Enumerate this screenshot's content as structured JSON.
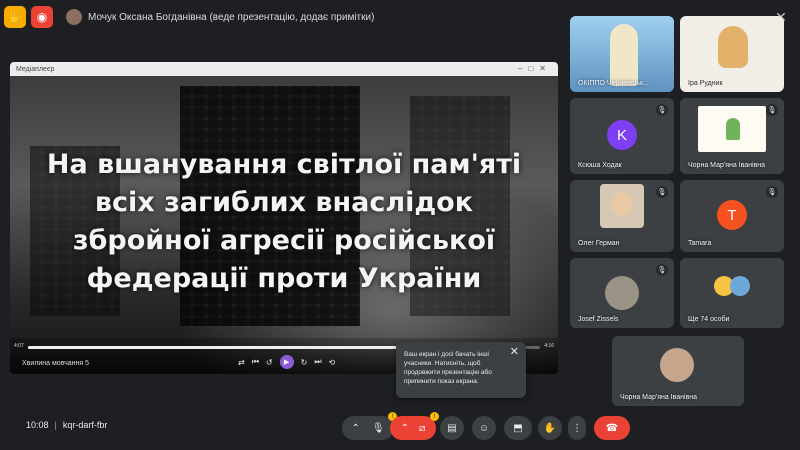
{
  "topbar": {
    "presenter_label": "Мочук Оксана Богданівна (веде презентацію, додає примітки)"
  },
  "presentation": {
    "window_title": "Медіаплеєр",
    "slide_title_lines": [
      "На вшанування світлої пам'яті",
      "всіх загиблих внаслідок",
      "збройної агресії російської",
      "федерації проти України"
    ],
    "media_label": "Хвилина мовчання 5",
    "progress_fraction": 0.96,
    "time_elapsed": "4:07",
    "time_total": "4:16"
  },
  "toast": {
    "message": "Ваш екран і досі бачать інші учасники. Натисніть, щоб продовжити презентацію або припинити показ екрана."
  },
  "participants": [
    {
      "name": "ОКІППО Чернівецьк...",
      "type": "video"
    },
    {
      "name": "Іра Рудник",
      "type": "video"
    },
    {
      "name": "Ксюша Ходак",
      "type": "letter",
      "letter": "K",
      "color": "#7e3ff2"
    },
    {
      "name": "Чорна Мар'яна Іванівна",
      "type": "presentation"
    },
    {
      "name": "Олег Герман",
      "type": "video"
    },
    {
      "name": "Tamara",
      "type": "letter",
      "letter": "T",
      "color": "#f4511e"
    },
    {
      "name": "Josef Zissels",
      "type": "photo"
    },
    {
      "name": "Ще 74 особи",
      "type": "group"
    },
    {
      "name": "Чорна Мар'яна Іванівна",
      "type": "photo"
    }
  ],
  "bottombar": {
    "time": "10:08",
    "meeting_code": "kqr-darf-fbr"
  },
  "colors": {
    "accent_red": "#ea4335",
    "warning_yellow": "#fbbc04",
    "tile_bg": "#3c4043"
  }
}
